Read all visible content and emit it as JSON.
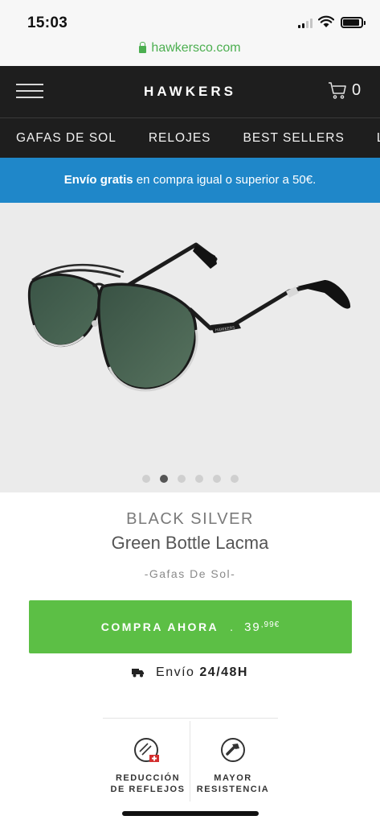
{
  "status_bar": {
    "time": "15:03"
  },
  "browser": {
    "url": "hawkersco.com"
  },
  "header": {
    "brand": "HAWKERS",
    "cart_count": "0"
  },
  "nav": {
    "items": [
      "GAFAS DE SOL",
      "RELOJES",
      "BEST SELLERS",
      "LIM"
    ]
  },
  "banner": {
    "bold": "Envío gratis",
    "rest": " en compra igual o superior a 50€."
  },
  "carousel": {
    "slide_count": 6,
    "active_index": 1,
    "temple_print": "HAWKERS"
  },
  "product": {
    "brand_line": "BLACK SILVER",
    "model": "Green Bottle Lacma",
    "category": "-Gafas De Sol-"
  },
  "buy_button": {
    "label": "COMPRA AHORA",
    "separator": ".",
    "price_main": "39",
    "price_cents": ",99€"
  },
  "shipping": {
    "label": "Envío",
    "time": "24/48H"
  },
  "features": [
    {
      "line1": "REDUCCIÓN",
      "line2": "DE REFLEJOS",
      "icon": "anti-reflection-icon"
    },
    {
      "line1": "MAYOR",
      "line2": "RESISTENCIA",
      "icon": "resistance-icon"
    }
  ],
  "colors": {
    "header_bg": "#1e1e1e",
    "banner_bg": "#1f87c9",
    "buy_green": "#5cbf45",
    "url_green": "#4caf50",
    "lens_green": "#3e5a48"
  }
}
